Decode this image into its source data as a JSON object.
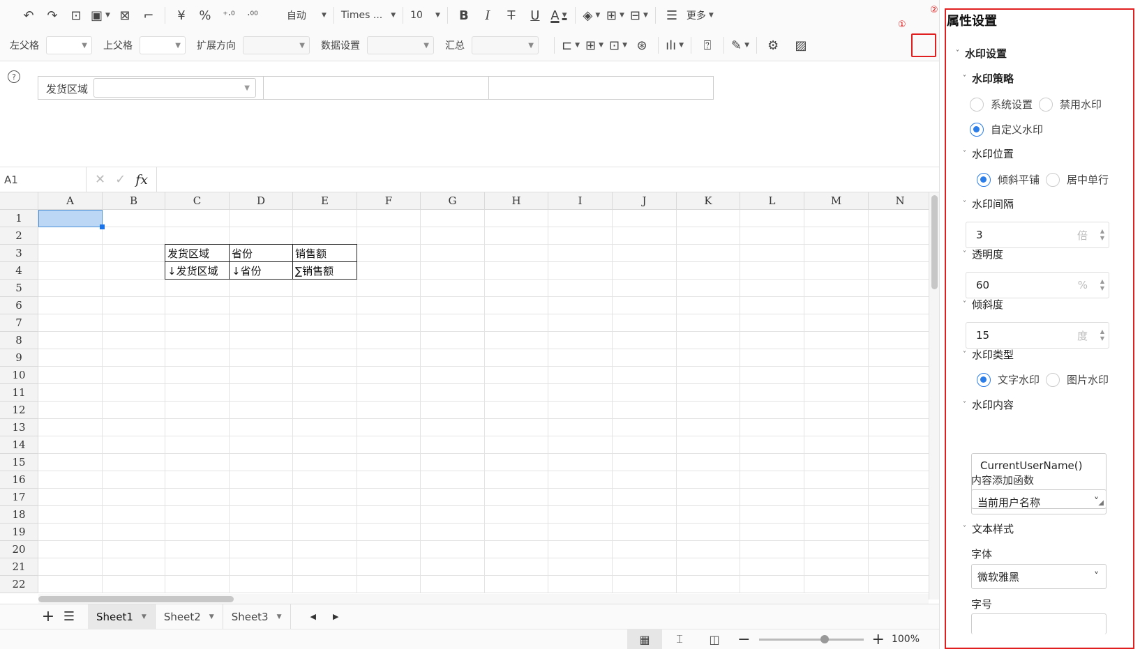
{
  "toolbar": {
    "format_auto": "自动",
    "font_name": "Times ...",
    "font_size": "10",
    "more": "更多",
    "currency": "¥",
    "percent": "%",
    "dec_add": "+.0\n.00",
    "dec_sub": ".00\n+.0",
    "bold": "B",
    "italic": "I",
    "strike": "T",
    "underline": "U",
    "fontcolor": "A"
  },
  "toolbar2": {
    "left_parent": "左父格",
    "top_parent": "上父格",
    "expand_dir": "扩展方向",
    "data_setting": "数据设置",
    "summary": "汇总"
  },
  "markers": {
    "m1": "①",
    "m2": "②"
  },
  "params": {
    "label": "发货区域",
    "help": "?"
  },
  "formula": {
    "cell": "A1",
    "fx": "fx",
    "cancel": "✕",
    "confirm": "✓"
  },
  "columns": [
    "A",
    "B",
    "C",
    "D",
    "E",
    "F",
    "G",
    "H",
    "I",
    "J",
    "K",
    "L",
    "M",
    "N"
  ],
  "rows": [
    "1",
    "2",
    "3",
    "4",
    "5",
    "6",
    "7",
    "8",
    "9",
    "10",
    "11",
    "12",
    "13",
    "14",
    "15",
    "16",
    "17",
    "18",
    "19",
    "20",
    "21",
    "22"
  ],
  "table": {
    "r3": [
      "发货区域",
      "省份",
      "销售额"
    ],
    "r4": [
      "↓发货区域",
      "↓省份",
      "∑销售额"
    ]
  },
  "sheets": [
    "Sheet1",
    "Sheet2",
    "Sheet3"
  ],
  "zoom": "100%",
  "panel": {
    "title": "属性设置",
    "watermark_setting": "水印设置",
    "strategy": "水印策略",
    "opt_system": "系统设置",
    "opt_disable": "禁用水印",
    "opt_custom": "自定义水印",
    "position": "水印位置",
    "opt_tile": "倾斜平铺",
    "opt_center": "居中单行",
    "spacing": "水印间隔",
    "spacing_value": "3",
    "spacing_unit": "倍",
    "opacity": "透明度",
    "opacity_value": "60",
    "opacity_unit": "%",
    "tilt": "倾斜度",
    "tilt_value": "15",
    "tilt_unit": "度",
    "type": "水印类型",
    "opt_text": "文字水印",
    "opt_image": "图片水印",
    "content": "水印内容",
    "content_value": "CurrentUserName()",
    "add_func": "内容添加函数",
    "add_func_value": "当前用户名称",
    "text_style": "文本样式",
    "font_label": "字体",
    "font_value": "微软雅黑",
    "size_label": "字号"
  }
}
